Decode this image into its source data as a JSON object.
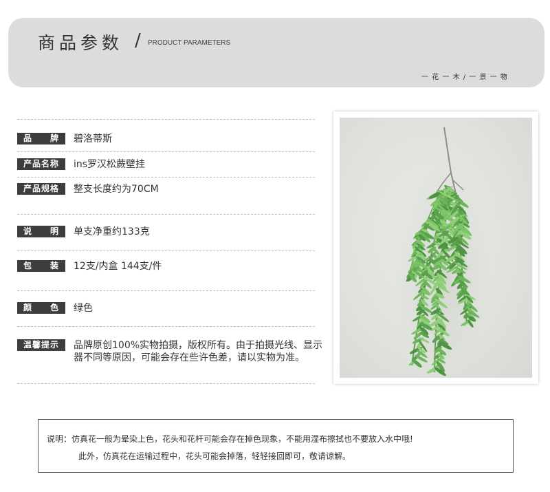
{
  "header": {
    "title": "商品参数",
    "slash": "/",
    "subtitle": "PRODUCT PARAMETERS",
    "tagline": "一 花 一 木 / 一 景 一 物",
    "background_color": "#dcdcdc"
  },
  "params": [
    {
      "label": "品　　牌",
      "value": "碧洛蒂斯"
    },
    {
      "label": "产品名称",
      "value": "ins罗汉松蕨壁挂"
    },
    {
      "label": "产品规格",
      "value": "整支长度约为70CM"
    },
    {
      "label": "说　　明",
      "value": "单支净重约133克"
    },
    {
      "label": "包　　装",
      "value": "12支/内盒  144支/件"
    },
    {
      "label": "颜　　色",
      "value": "绿色"
    },
    {
      "label": "温馨提示",
      "value": "品牌原创100%实物拍摄，版权所有。由于拍摄光线、显示器不同等原因，可能会存在些许色差，请以实物为准。"
    }
  ],
  "photo": {
    "subject": "hanging-fern-plant",
    "leaf_color": "#6cb55a"
  },
  "notice": {
    "line1": "说明：仿真花一般为晕染上色，花头和花杆可能会存在掉色现象，不能用湿布擦拭也不要放入水中哦!",
    "line2": "此外，仿真花在运输过程中，花头可能会掉落，轻轻接回即可，敬请谅解。"
  }
}
